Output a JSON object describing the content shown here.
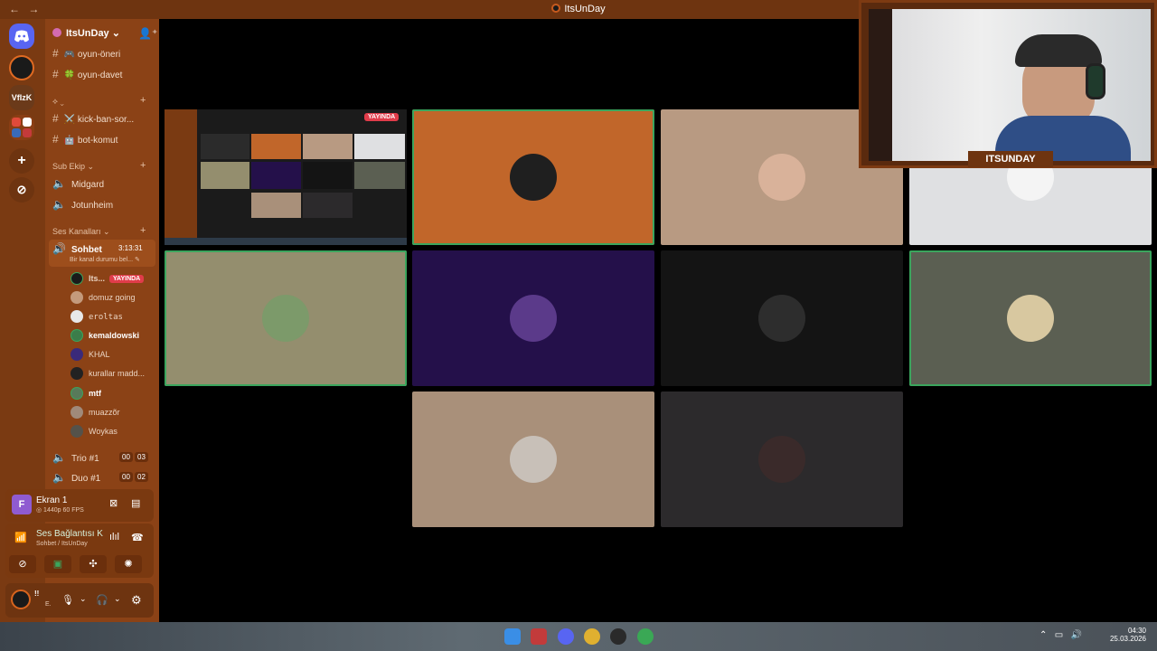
{
  "window": {
    "title": "ItsUnDay",
    "back": "←",
    "forward": "→"
  },
  "guilds": {
    "discord_label": "",
    "vfzk_label": "VfIzK"
  },
  "server": {
    "name": "ItsUnDay ⌄"
  },
  "channels": {
    "top": [
      {
        "emoji": "🎮",
        "name": "oyun-öneri"
      },
      {
        "emoji": "🍀",
        "name": "oyun-davet"
      }
    ],
    "cat1": "⟡ ⌄",
    "mod": [
      {
        "emoji": "⚔️",
        "name": "kick-ban-sor..."
      },
      {
        "emoji": "🤖",
        "name": "bot-komut"
      }
    ],
    "cat_sub": "Sub Ekip ⌄",
    "sub": [
      {
        "name": "Midgard"
      },
      {
        "name": "Jotunheim"
      }
    ],
    "cat_voice": "Ses Kanalları ⌄",
    "voice": {
      "name": "Sohbet",
      "timer": "3:13:31",
      "status": "Bir kanal durumu bel... ✎"
    },
    "users": [
      {
        "name": "Its...",
        "live": "YAYINDA",
        "color": "#1a1a1a"
      },
      {
        "name": "domuz going",
        "color": "#c49a7c"
      },
      {
        "name": "eroltas",
        "color": "#e8e8e8"
      },
      {
        "name": "kemaldowski",
        "color": "#3b7d4a"
      },
      {
        "name": "KHAL",
        "color": "#3a2a7a"
      },
      {
        "name": "kurallar madd...",
        "color": "#222"
      },
      {
        "name": "mtf",
        "color": "#587a5a"
      },
      {
        "name": "muazzõr",
        "color": "#a08a7a"
      },
      {
        "name": "Woykas",
        "color": "#55524a"
      }
    ],
    "other_voice": [
      {
        "name": "Trio #1",
        "c1": "00",
        "c2": "03"
      },
      {
        "name": "Duo #1",
        "c1": "00",
        "c2": "02"
      }
    ]
  },
  "stream_panel": {
    "title": "Ekran 1",
    "sub": "◎ 1440p 60 FPS",
    "initial": "F"
  },
  "voice_panel": {
    "title": "Ses Bağlantısı K",
    "sub": "Sohbet / ItsUnDay"
  },
  "user_panel": {
    "name": "!!",
    "sub": "E."
  },
  "grid": {
    "live_badge": "YAYINDA",
    "tiles": [
      {
        "bg": "#c1662a",
        "avatar": "#1f1f1f",
        "speaking": true
      },
      {
        "bg": "#b89a82",
        "avatar": "#d9b29a",
        "speaking": false
      },
      {
        "bg": "#dfe0e2",
        "avatar": "#f4f4f4",
        "speaking": false
      },
      {
        "bg": "#948e6e",
        "avatar": "#7c9a6a",
        "speaking": true
      },
      {
        "bg": "#24104a",
        "avatar": "#5b3a8a",
        "speaking": false
      },
      {
        "bg": "#141414",
        "avatar": "#2d2d2d",
        "speaking": false
      },
      {
        "bg": "#5b5f52",
        "avatar": "#d8c8a0",
        "speaking": true
      },
      {
        "bg": "#a9907a",
        "avatar": "#c8c0b8",
        "speaking": false
      },
      {
        "bg": "#2c2a2c",
        "avatar": "#3a2a2a",
        "speaking": false
      }
    ]
  },
  "webcam": {
    "label": "ITSUNDAY"
  },
  "taskbar": {
    "time": "04:30",
    "date": "25.03.2026"
  }
}
